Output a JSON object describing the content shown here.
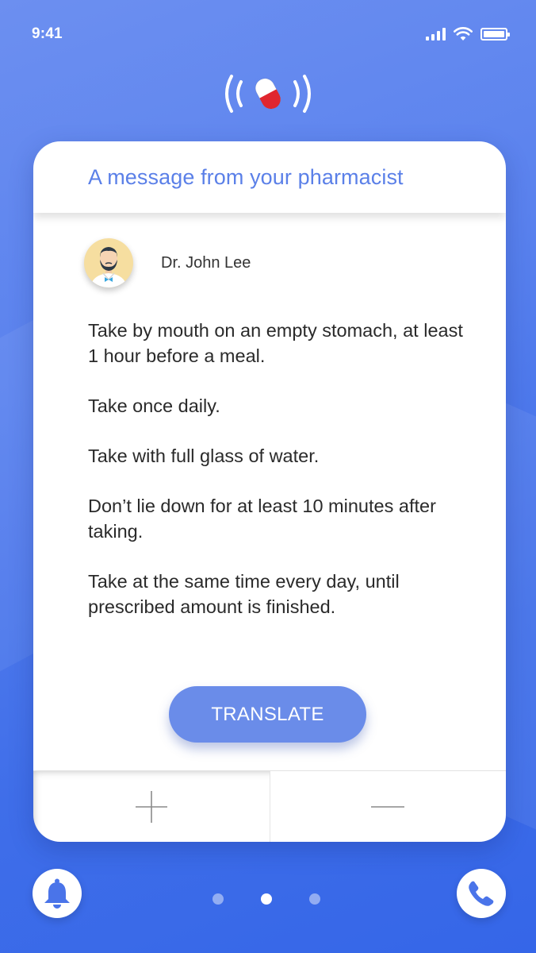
{
  "status_bar": {
    "time": "9:41"
  },
  "card": {
    "title": "A message from your pharmacist",
    "pharmacist_name": "Dr. John Lee",
    "instructions": [
      "Take by mouth on an empty stomach, at least 1 hour before a meal.",
      "Take once daily.",
      "Take with full glass of water.",
      "Don’t lie down for at least 10 minutes after taking.",
      "Take at the same time every day, until prescribed amount is finished."
    ],
    "translate_label": "TRANSLATE"
  },
  "pagination": {
    "total": 3,
    "active": 2
  },
  "icons": {
    "top": "pill-broadcast-icon",
    "bottom_left": "bell-icon",
    "bottom_right": "phone-icon",
    "stepper_left": "plus-icon",
    "stepper_right": "minus-icon"
  },
  "colors": {
    "accent": "#5b80e8",
    "button": "#6a8ce9",
    "pill_red": "#e0262f"
  }
}
